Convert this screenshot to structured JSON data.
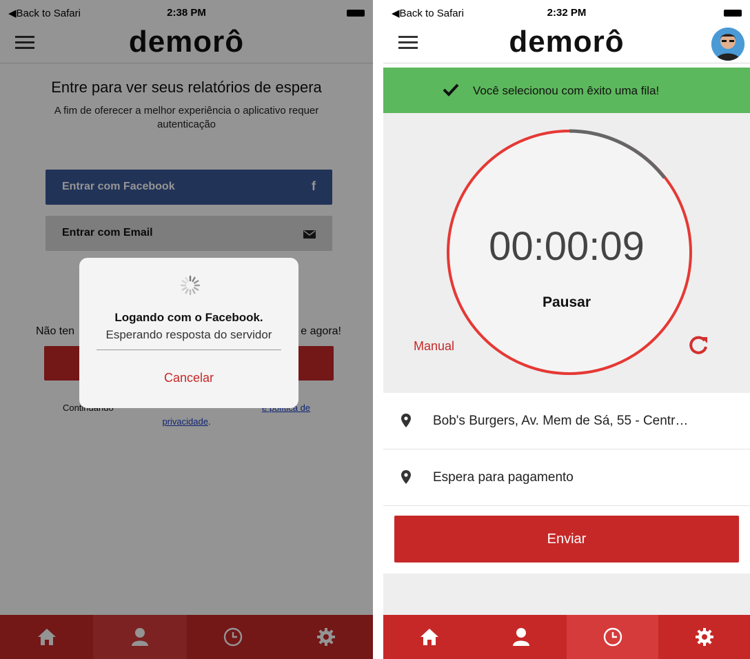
{
  "left": {
    "status": {
      "back": "◀Back to Safari",
      "time": "2:38 PM"
    },
    "logo": "demorô",
    "login": {
      "title": "Entre para ver seus relatórios de espera",
      "subtitle": "A fim de oferecer a melhor experiência o aplicativo requer autenticação",
      "facebook_label": "Entrar com Facebook",
      "facebook_icon": "f",
      "email_label": "Entrar com Email",
      "no_account_left": "Não ten",
      "no_account_right": "e agora!",
      "terms_prefix": "Continuando",
      "terms_link_partial": "e política de",
      "terms_link_line2": "privacidade",
      "terms_suffix": "."
    },
    "dialog": {
      "title": "Logando com o Facebook.",
      "message": "Esperando resposta do servidor",
      "cancel": "Cancelar"
    },
    "tabs": [
      "home-icon",
      "user-icon",
      "clock-icon",
      "gear-icon"
    ],
    "active_tab": 1
  },
  "right": {
    "status": {
      "back": "◀Back to Safari",
      "time": "2:32 PM"
    },
    "logo": "demorô",
    "banner": {
      "check": "✔",
      "text": "Você selecionou com êxito uma fila!"
    },
    "timer": {
      "value": "00:00:09",
      "pause_label": "Pausar",
      "manual_label": "Manual"
    },
    "rows": [
      {
        "icon": "location-pin-icon",
        "text": "Bob's Burgers, Av. Mem de Sá, 55 - Centr…"
      },
      {
        "icon": "location-pin-icon",
        "text": "Espera para pagamento"
      }
    ],
    "send_label": "Enviar",
    "tabs": [
      "home-icon",
      "user-icon",
      "clock-icon",
      "gear-icon"
    ],
    "active_tab": 2
  },
  "colors": {
    "brand_red": "#c62828",
    "facebook_blue": "#3b5998",
    "success_green": "#5cb85c"
  }
}
